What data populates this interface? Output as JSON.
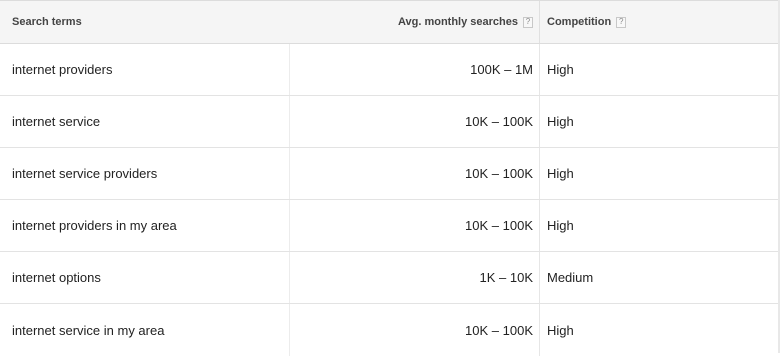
{
  "table": {
    "headers": {
      "term": "Search terms",
      "searches": "Avg. monthly searches",
      "competition": "Competition",
      "help_glyph": "?"
    },
    "rows": [
      {
        "term": "internet providers",
        "searches": "100K – 1M",
        "competition": "High"
      },
      {
        "term": "internet service",
        "searches": "10K – 100K",
        "competition": "High"
      },
      {
        "term": "internet service providers",
        "searches": "10K – 100K",
        "competition": "High"
      },
      {
        "term": "internet providers in my area",
        "searches": "10K – 100K",
        "competition": "High"
      },
      {
        "term": "internet options",
        "searches": "1K – 10K",
        "competition": "Medium"
      },
      {
        "term": "internet service in my area",
        "searches": "10K – 100K",
        "competition": "High"
      }
    ]
  }
}
